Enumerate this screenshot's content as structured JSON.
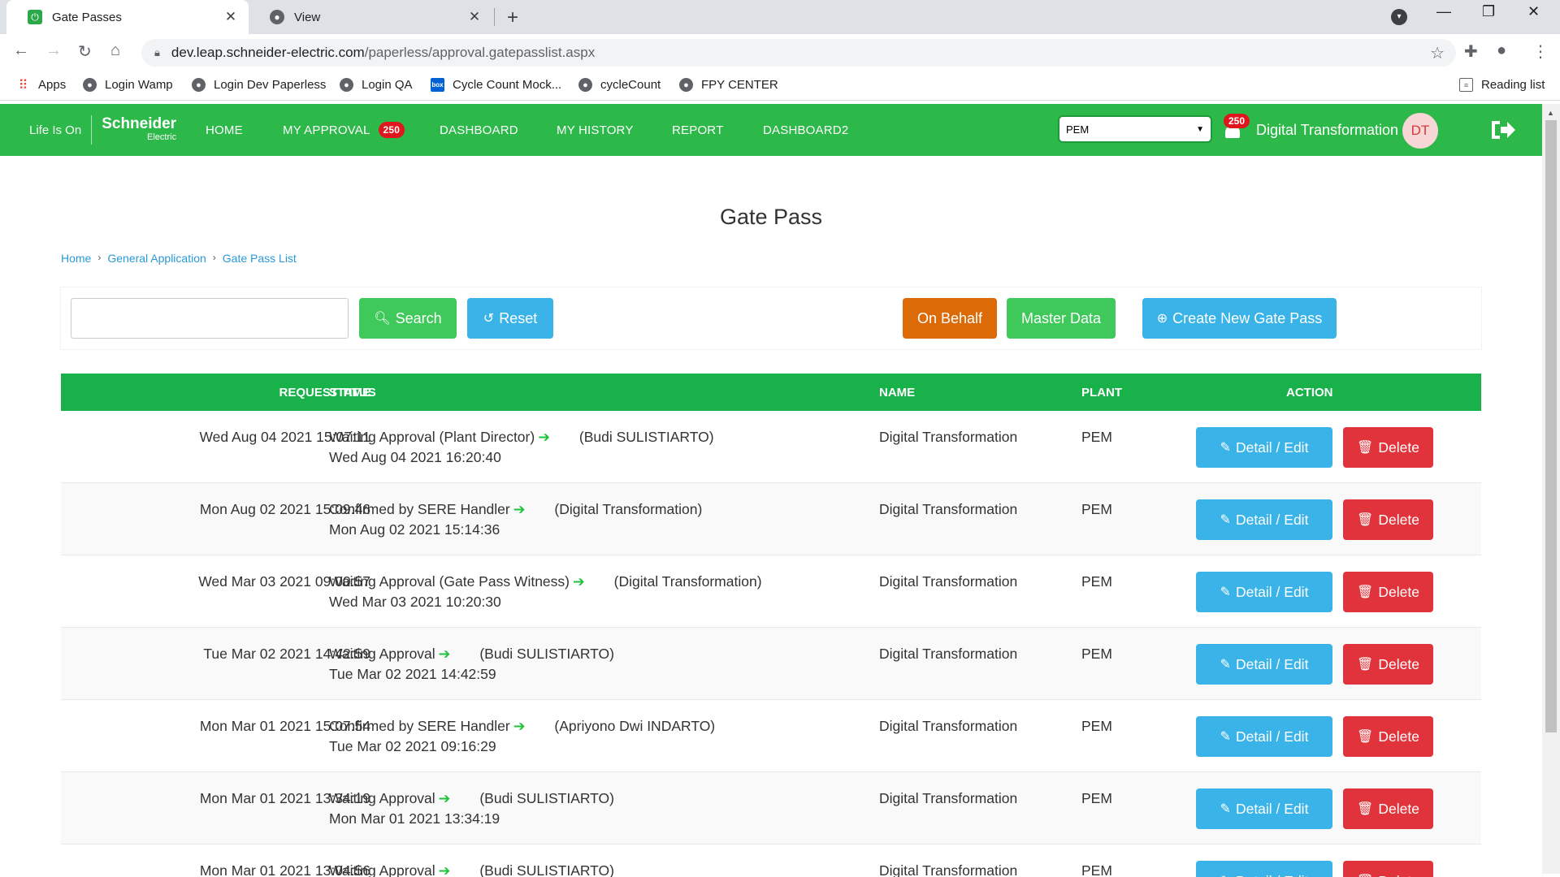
{
  "browser": {
    "tabs": [
      {
        "title": "Gate Passes",
        "active": true,
        "favicon": "power-icon"
      },
      {
        "title": "View",
        "active": false,
        "favicon": "globe-icon"
      }
    ],
    "url_host": "dev.leap.schneider-electric.com",
    "url_path": "/paperless/approval.gatepasslist.aspx",
    "bookmarks": [
      {
        "label": "Apps",
        "icon": "apps-grid-icon"
      },
      {
        "label": "Login Wamp",
        "icon": "globe-icon"
      },
      {
        "label": "Login Dev Paperless",
        "icon": "globe-icon"
      },
      {
        "label": "Login QA",
        "icon": "globe-icon"
      },
      {
        "label": "Cycle Count Mock...",
        "icon": "box-icon"
      },
      {
        "label": "cycleCount",
        "icon": "globe-icon"
      },
      {
        "label": "FPY CENTER",
        "icon": "globe-icon"
      }
    ],
    "reading_list": "Reading list"
  },
  "header": {
    "tagline": "Life Is On",
    "brand": "Schneider",
    "brand_sub": "Electric",
    "menu": {
      "home": "HOME",
      "my_approval": "MY APPROVAL",
      "my_approval_count": "250",
      "dashboard": "DASHBOARD",
      "my_history": "MY HISTORY",
      "report": "REPORT",
      "dashboard2": "DASHBOARD2"
    },
    "plant_selected": "PEM",
    "notification_count": "250",
    "user_name": "Digital Transformation",
    "avatar_initials": "DT",
    "colors": {
      "primary": "#2db84a",
      "badge": "#e0161e"
    }
  },
  "page": {
    "title": "Gate Pass",
    "breadcrumb": [
      "Home",
      "General Application",
      "Gate Pass List"
    ]
  },
  "toolbar": {
    "search_placeholder": "",
    "search_label": "Search",
    "reset_label": "Reset",
    "on_behalf_label": "On Behalf",
    "master_data_label": "Master Data",
    "create_label": "Create New Gate Pass"
  },
  "table": {
    "headers": {
      "request_time": "REQUEST TIME",
      "status": "STATUS",
      "name": "NAME",
      "plant": "PLANT",
      "action": "ACTION"
    },
    "edit_label": "Detail / Edit",
    "delete_label": "Delete",
    "rows": [
      {
        "request_time": "Wed Aug 04 2021 15:07:11",
        "status": "Waiting Approval (Plant Director)",
        "approver": "(Budi SULISTIARTO)",
        "status_time": "Wed Aug 04 2021 16:20:40",
        "name": "Digital Transformation",
        "plant": "PEM"
      },
      {
        "request_time": "Mon Aug 02 2021 15:09:46",
        "status": "Confirmed by SERE Handler",
        "approver": "(Digital Transformation)",
        "status_time": "Mon Aug 02 2021 15:14:36",
        "name": "Digital Transformation",
        "plant": "PEM"
      },
      {
        "request_time": "Wed Mar 03 2021 09:00:57",
        "status": "Waiting Approval (Gate Pass Witness)",
        "approver": "(Digital Transformation)",
        "status_time": "Wed Mar 03 2021 10:20:30",
        "name": "Digital Transformation",
        "plant": "PEM"
      },
      {
        "request_time": "Tue Mar 02 2021 14:42:59",
        "status": "Waiting Approval",
        "approver": "(Budi SULISTIARTO)",
        "status_time": "Tue Mar 02 2021 14:42:59",
        "name": "Digital Transformation",
        "plant": "PEM"
      },
      {
        "request_time": "Mon Mar 01 2021 15:07:54",
        "status": "Confirmed by SERE Handler",
        "approver": "(Apriyono Dwi INDARTO)",
        "status_time": "Tue Mar 02 2021 09:16:29",
        "name": "Digital Transformation",
        "plant": "PEM"
      },
      {
        "request_time": "Mon Mar 01 2021 13:34:19",
        "status": "Waiting Approval",
        "approver": "(Budi SULISTIARTO)",
        "status_time": "Mon Mar 01 2021 13:34:19",
        "name": "Digital Transformation",
        "plant": "PEM"
      },
      {
        "request_time": "Mon Mar 01 2021 13:04:56",
        "status": "Waiting Approval",
        "approver": "(Budi SULISTIARTO)",
        "status_time": "",
        "name": "Digital Transformation",
        "plant": "PEM"
      }
    ]
  }
}
